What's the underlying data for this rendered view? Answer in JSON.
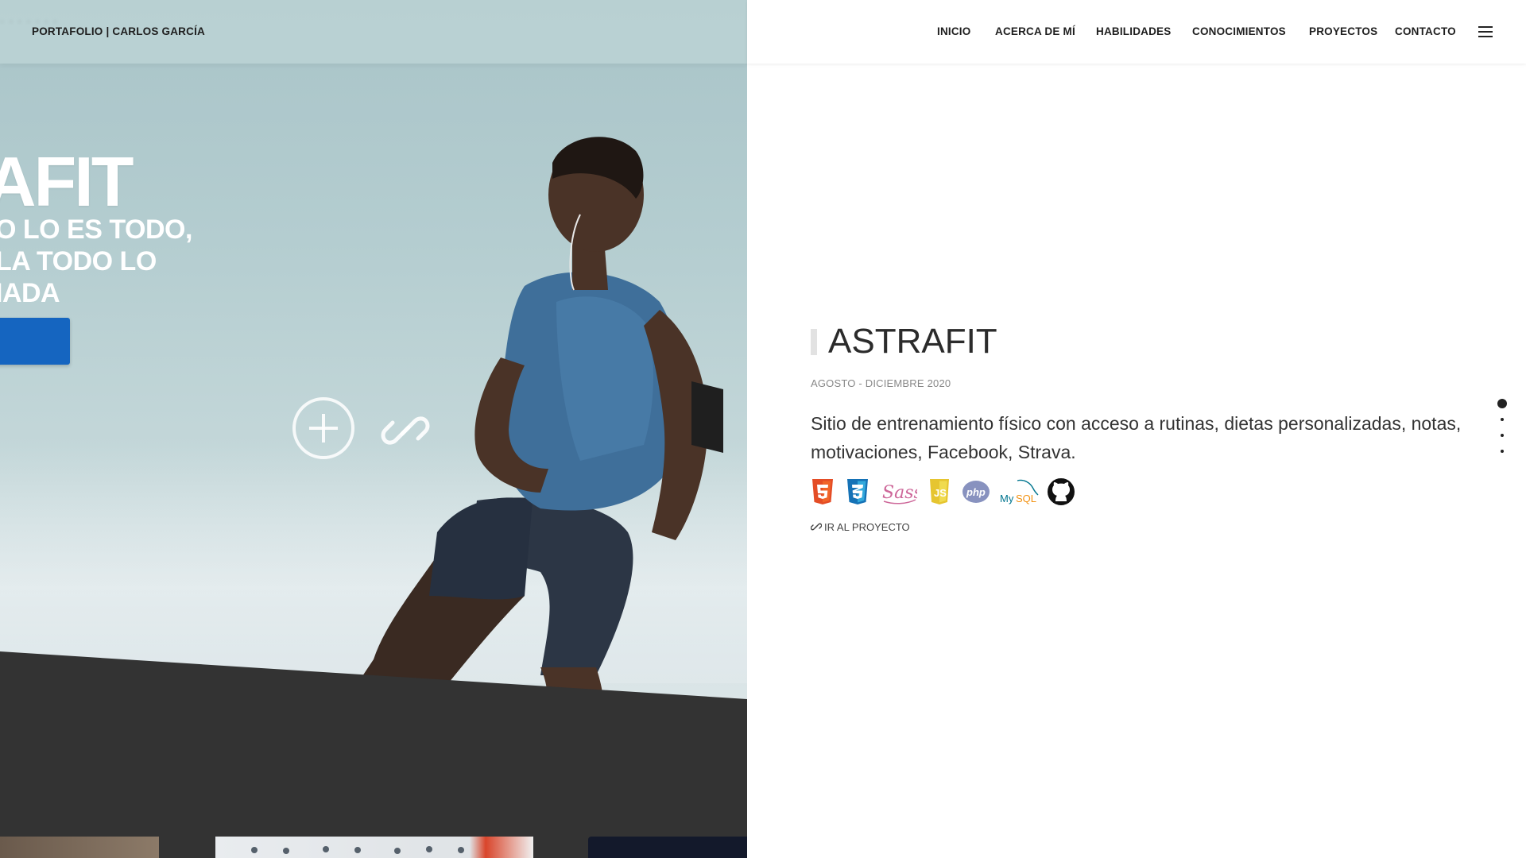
{
  "brand": "PORTAFOLIO | CARLOS GARCÍA",
  "nav": {
    "items": [
      "INICIO",
      "ACERCA DE MÍ",
      "HABILIDADES",
      "CONOCIMIENTOS",
      "PROYECTOS",
      "CONTACTO"
    ],
    "menu_icon": "hamburger-menu-icon"
  },
  "hero": {
    "title_partial": "AFIT",
    "subtitle_lines": [
      "O LO ES TODO,",
      "LA TODO LO",
      "IADA"
    ],
    "cta_color": "#1565c0",
    "overlay_icons": [
      "plus-circle-icon",
      "link-icon"
    ]
  },
  "project": {
    "title": "ASTRAFIT",
    "dates": "AGOSTO - DICIEMBRE 2020",
    "description": "Sitio de entrenamiento físico con acceso a rutinas, dietas personalizadas, notas, motivaciones, Facebook, Strava.",
    "technologies": [
      "html5-icon",
      "css3-icon",
      "sass-icon",
      "javascript-icon",
      "php-icon",
      "mysql-icon",
      "github-icon"
    ],
    "tech_labels": {
      "mysql": "MySQL",
      "sass": "Sass",
      "php": "php",
      "js": "JS"
    },
    "link_label": "IR AL PROYECTO",
    "link_icon": "link-icon"
  },
  "pagination": {
    "active_index": 0,
    "total": 4
  },
  "colors": {
    "accent": "#1565c0",
    "dark_band": "#333333",
    "html5": "#e44d26",
    "css3": "#1572b6",
    "sass": "#cd6799",
    "js": "#f0db4f",
    "php": "#8892bf",
    "mysql": "#00758f"
  }
}
